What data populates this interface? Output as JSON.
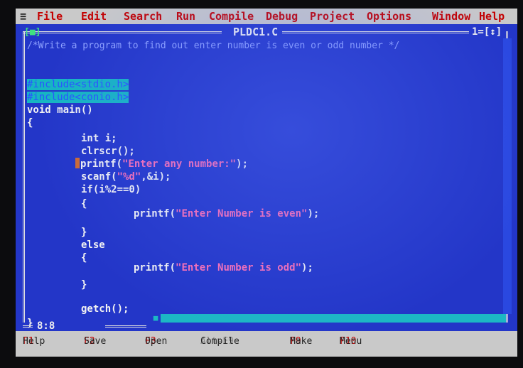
{
  "menu": {
    "system_icon": "≡",
    "items": [
      {
        "label": "File"
      },
      {
        "label": "Edit"
      },
      {
        "label": "Search"
      },
      {
        "label": "Run"
      },
      {
        "label": "Compile"
      },
      {
        "label": "Debug"
      },
      {
        "label": "Project"
      },
      {
        "label": "Options"
      },
      {
        "label": "Window"
      },
      {
        "label": "Help"
      }
    ]
  },
  "window": {
    "close_box": "[■]",
    "file_name": "PLDC1.C",
    "window_number": "1=[↕]"
  },
  "editor": {
    "lines": [
      "/*Write a program to find out enter number is even or odd number */",
      "",
      "#include<stdio.h>",
      "#include<conio.h>",
      "void main()",
      "{",
      "int i;",
      "clrscr();",
      "printf(",
      "\"Enter any number:\"",
      ");",
      "scanf(",
      "\"%d\"",
      ",&i);",
      "if(i%2==0)",
      "{",
      "printf(",
      "\"Enter Number is even\"",
      ");",
      "}",
      "else",
      "{",
      "printf(",
      "\"Enter Number is odd\"",
      ");",
      "}",
      "getch();",
      "}"
    ],
    "cursor_position": "8:8"
  },
  "statusbar": {
    "items": [
      {
        "key": "F1",
        "label": "Help"
      },
      {
        "key": "F2",
        "label": "Save"
      },
      {
        "key": "F3",
        "label": "Open"
      },
      {
        "key": "Alt-F9",
        "label": "Compile"
      },
      {
        "key": "F9",
        "label": "Make"
      },
      {
        "key": "F10",
        "label": "Menu"
      }
    ]
  }
}
